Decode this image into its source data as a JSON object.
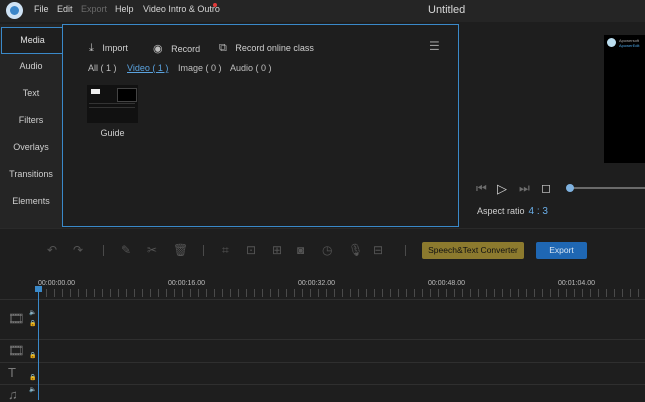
{
  "titlebar": {
    "menus": [
      "File",
      "Edit",
      "Export",
      "Help",
      "Video Intro & Outro"
    ],
    "title": "Untitled"
  },
  "sidebar": {
    "tabs": [
      "Media",
      "Audio",
      "Text",
      "Filters",
      "Overlays",
      "Transitions",
      "Elements"
    ],
    "active": "Media"
  },
  "media": {
    "import_label": "Import",
    "record_label": "Record",
    "record_online_label": "Record online class",
    "filters": [
      "All ( 1 )",
      "Video ( 1 )",
      "Image ( 0 )",
      "Audio ( 0 )"
    ],
    "active_filter": "Video ( 1 )",
    "items": [
      {
        "name": "Guide"
      }
    ]
  },
  "preview": {
    "overlay_line1": "Apowersoft",
    "overlay_line2": "ApowerEdit",
    "aspect_label": "Aspect ratio",
    "aspect_value": "4 : 3",
    "progress": 0
  },
  "toolbar": {
    "speech_text_label": "Speech&Text Converter",
    "export_label": "Export"
  },
  "timeline": {
    "timestamps": [
      "00:00:00.00",
      "00:00:16.00",
      "00:00:32.00",
      "00:00:48.00",
      "00:01:04.00"
    ]
  },
  "colors": {
    "accent": "#3a89c9",
    "export_button": "#1f67b3",
    "speech_button": "#8c7a2e"
  }
}
